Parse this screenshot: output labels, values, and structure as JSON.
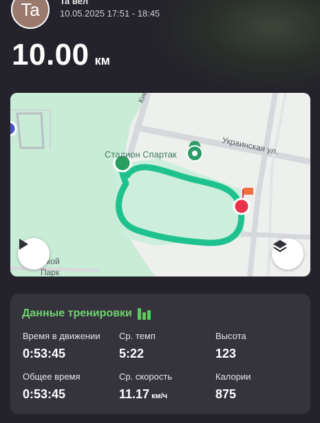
{
  "header": {
    "avatar_initials": "Ta",
    "user_name": "Ta вел",
    "timestamp": "10.05.2025 17:51 - 18:45",
    "distance_value": "10.00",
    "distance_unit": "км"
  },
  "map": {
    "stadium_label": "Стадион Спартак",
    "street_label": "Украинская ул.",
    "street2_label": "Книжн",
    "park_label_line1": "дской",
    "park_label_line2": "Парк",
    "play_icon": "play-icon",
    "layers_icon": "layers-icon",
    "route_color": "#1fc28e",
    "start_marker_color": "#2aa060",
    "finish_marker_color": "#e8334a"
  },
  "stats": {
    "title": "Данные тренировки",
    "title_icon": "bar-chart-icon",
    "moving_time_label": "Время в движении",
    "moving_time_value": "0:53:45",
    "avg_pace_label": "Ср. темп",
    "avg_pace_value": "5:22",
    "altitude_label": "Высота",
    "altitude_value": "123",
    "total_time_label": "Общее время",
    "total_time_value": "0:53:45",
    "avg_speed_label": "Ср. скорость",
    "avg_speed_value": "11.17",
    "avg_speed_unit": "км/ч",
    "calories_label": "Калории",
    "calories_value": "875"
  }
}
